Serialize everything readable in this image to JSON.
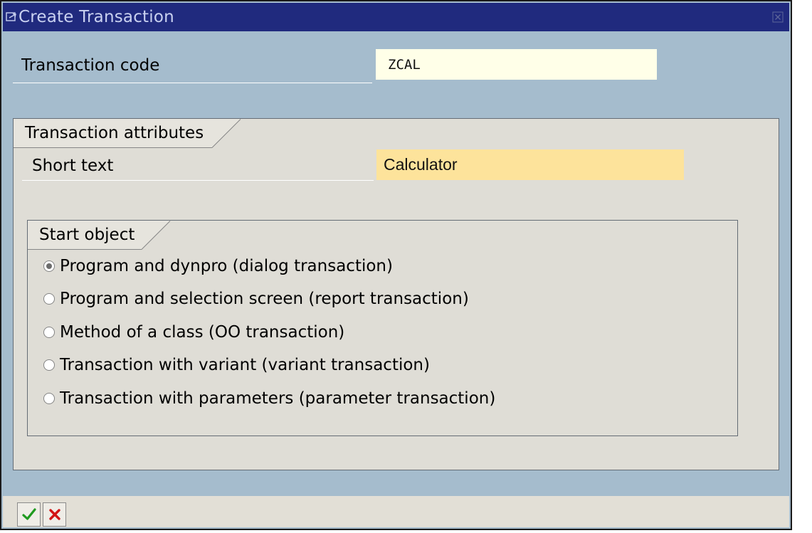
{
  "window": {
    "title": "Create Transaction"
  },
  "transaction_code": {
    "label": "Transaction code",
    "value": "ZCAL"
  },
  "attributes_group": {
    "title": "Transaction attributes",
    "short_text": {
      "label": "Short text",
      "value": "Calculator"
    }
  },
  "start_object_group": {
    "title": "Start object",
    "options": [
      {
        "label": "Program and dynpro (dialog transaction)",
        "selected": true
      },
      {
        "label": "Program and selection screen (report transaction)",
        "selected": false
      },
      {
        "label": "Method of a class (OO transaction)",
        "selected": false
      },
      {
        "label": "Transaction with variant (variant transaction)",
        "selected": false
      },
      {
        "label": "Transaction with parameters (parameter transaction)",
        "selected": false
      }
    ]
  },
  "icons": {
    "title": "dialog-icon",
    "close": "close-icon",
    "confirm": "check-icon",
    "cancel": "cancel-icon"
  },
  "colors": {
    "titlebar": "#202a7e",
    "background": "#a5bccd",
    "required_input": "#fde39b",
    "input": "#ffffe8",
    "confirm": "#1f9a1f",
    "cancel": "#d21414"
  }
}
